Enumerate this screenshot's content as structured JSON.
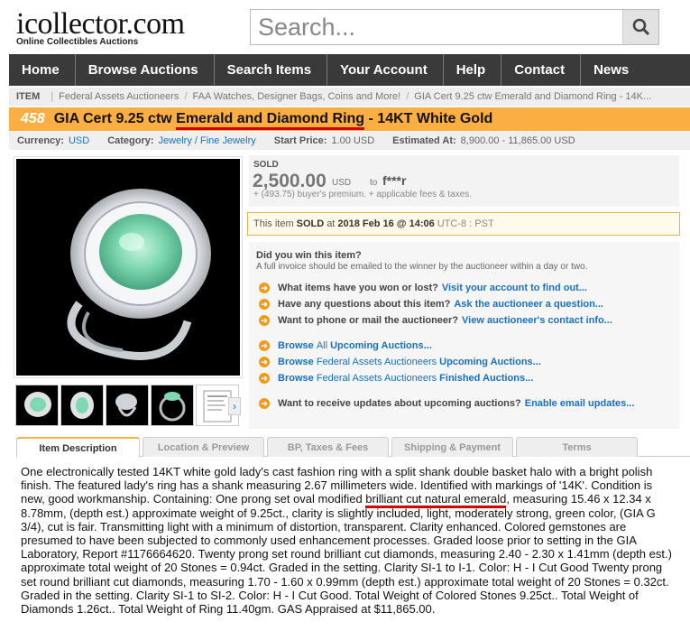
{
  "header": {
    "logo_text": "icollector.com",
    "logo_sub": "Online Collectibles Auctions",
    "search_placeholder": "Search..."
  },
  "nav": [
    "Home",
    "Browse Auctions",
    "Search Items",
    "Your Account",
    "Help",
    "Contact",
    "News"
  ],
  "breadcrumb": {
    "label": "ITEM",
    "links": [
      "Federal Assets Auctioneers",
      "FAA Watches, Designer Bags, Coins and More!",
      "GIA Cert 9.25 ctw Emerald and Diamond Ring - 14K..."
    ]
  },
  "item": {
    "lot": "458",
    "title_pre": "GIA Cert 9.25 ctw ",
    "title_hl": "Emerald and Diamond Ring",
    "title_post": " - 14KT White Gold"
  },
  "info": {
    "currency_label": "Currency:",
    "currency": "USD",
    "category_label": "Category:",
    "category": "Jewelry / Fine Jewelry",
    "start_label": "Start Price:",
    "start": "1.00 USD",
    "estimate_label": "Estimated At:",
    "estimate": "8,900.00 - 11,865.00 USD"
  },
  "sold": {
    "label": "SOLD",
    "price": "2,500.00",
    "currency": "USD",
    "to": "to",
    "winner": "f***r",
    "fees": "+ (493.75) buyer's premium. + applicable fees & taxes.",
    "msg_pre": "This item",
    "msg_sold": "SOLD",
    "msg_at": "at",
    "msg_date": "2018 Feb 16 @ 14:06",
    "msg_tz": "UTC-8 : PST"
  },
  "win": {
    "question": "Did you win this item?",
    "note": "A full invoice should be emailed to the winner by the auctioneer within a day or two."
  },
  "questions": [
    {
      "q": "What items have you won or lost?",
      "link": "Visit your account to find out..."
    },
    {
      "q": "Have any questions about this item?",
      "link": "Ask the auctioneer a question..."
    },
    {
      "q": "Want to phone or mail the auctioneer?",
      "link": "View auctioneer's contact info..."
    }
  ],
  "browse": [
    {
      "a": "Browse",
      "b": "All",
      "c": "Upcoming Auctions..."
    },
    {
      "a": "Browse",
      "b": "Federal Assets Auctioneers",
      "c": "Upcoming Auctions..."
    },
    {
      "a": "Browse",
      "b": "Federal Assets Auctioneers",
      "c": "Finished Auctions..."
    }
  ],
  "updates": {
    "q": "Want to receive updates about upcoming auctions?",
    "link": "Enable email updates..."
  },
  "tabs": [
    "Item Description",
    "Location & Preview",
    "BP, Taxes & Fees",
    "Shipping & Payment",
    "Terms"
  ],
  "description": {
    "pre": "One electronically tested 14KT white gold lady's cast fashion ring with a split shank double basket halo with a bright polish finish. The featured lady's ring has a shank measuring 2.67 millimeters wide. Identified with markings of '14K'. Condition is new, good workmanship. Containing: One prong set oval modified ",
    "hl": "brilliant cut natural emerald",
    "post": ", measuring 15.46 x 12.34 x 8.78mm, (depth est.) approximate weight of 9.25ct., clarity is slightly included, light, moderately strong, green color, (GIA G 3/4), cut is fair. Transmitting light with a minimum of distortion, transparent. Clarity enhanced. Colored gemstones are presumed to have been subjected to commonly used enhancement processes. Graded loose prior to setting in the GIA Laboratory, Report #1176664620. Twenty prong set round brilliant cut diamonds, measuring 2.40 - 2.30 x 1.41mm (depth est.) approximate total weight of 20 Stones = 0.94ct. Graded in the setting. Clarity SI-1 to I-1. Color: H - I Cut Good Twenty prong set round brilliant cut diamonds, measuring 1.70 - 1.60 x 0.99mm (depth est.) approximate total weight of 20 Stones = 0.32ct. Graded in the setting. Clarity SI-1 to SI-2. Color: H - I Cut Good. Total Weight of Colored Stones 9.25ct.. Total Weight of Diamonds 1.26ct.. Total Weight of Ring 11.40gm. GAS Appraised at $11,865.00."
  },
  "colors": {
    "accent": "#fbae41",
    "nav_bg": "#3a3a3a",
    "link": "#1a70c0",
    "highlight": "#d40000"
  }
}
